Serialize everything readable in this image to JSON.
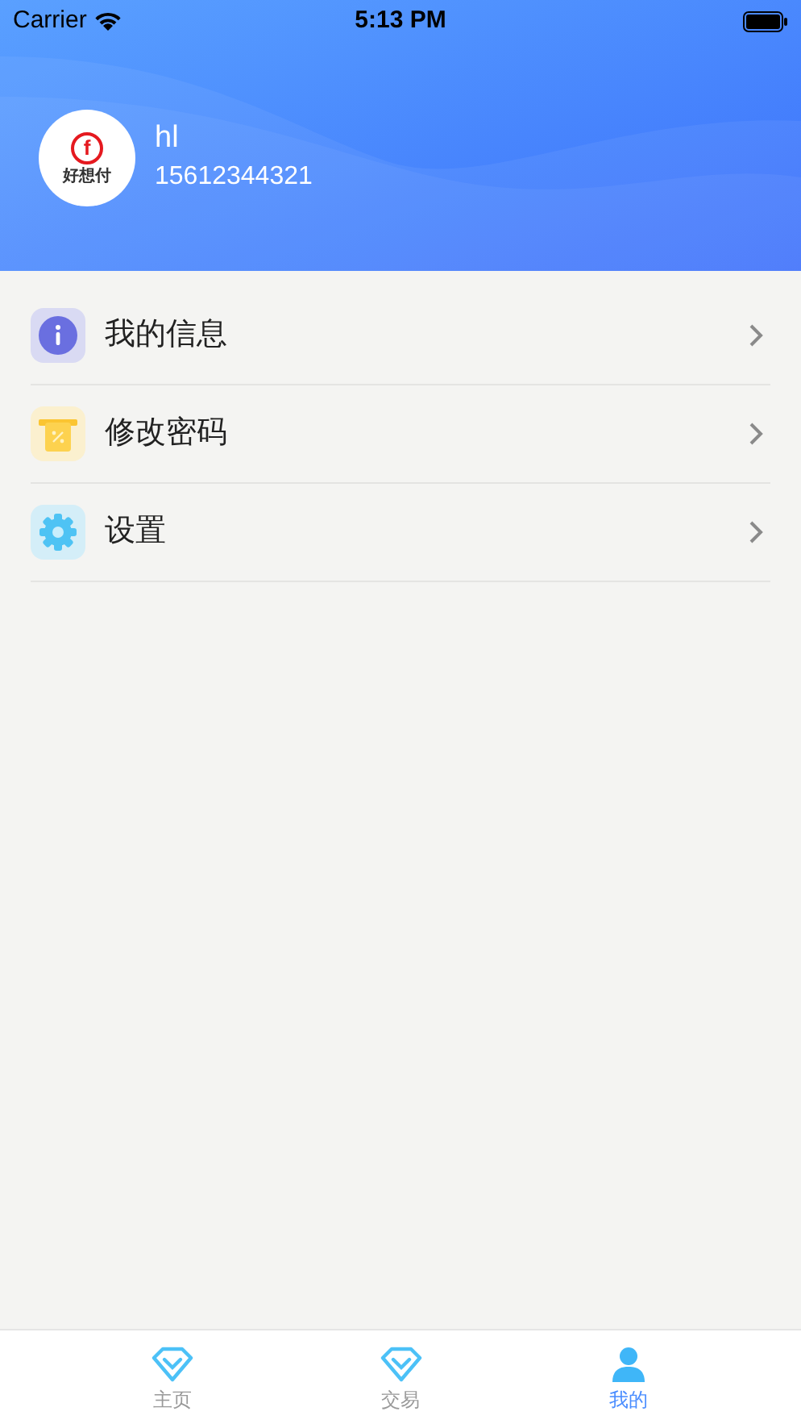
{
  "status_bar": {
    "carrier": "Carrier",
    "time": "5:13 PM"
  },
  "profile": {
    "logo_mark": "f",
    "logo_text": "好想付",
    "name": "hl",
    "phone": "15612344321"
  },
  "menu": [
    {
      "kind": "info",
      "label": "我的信息"
    },
    {
      "kind": "password",
      "label": "修改密码"
    },
    {
      "kind": "settings",
      "label": "设置"
    }
  ],
  "tabs": [
    {
      "kind": "diamond",
      "label": "主页",
      "selected": false
    },
    {
      "kind": "diamond",
      "label": "交易",
      "selected": false
    },
    {
      "kind": "person",
      "label": "我的",
      "selected": true
    }
  ]
}
